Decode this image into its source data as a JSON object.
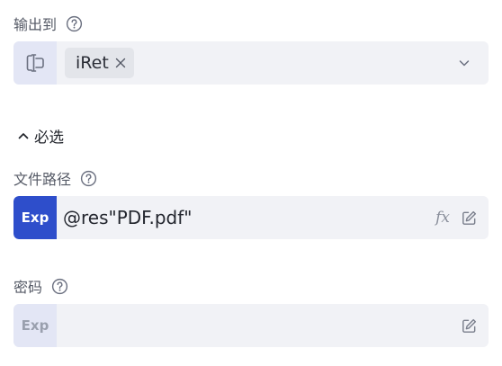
{
  "output_to": {
    "label": "输出到",
    "variable_icon": "variable-icon",
    "tag": {
      "text": "iRet",
      "close_icon": "close-icon"
    },
    "dropdown_icon": "chevron-down-icon"
  },
  "required_section": {
    "caret_icon": "chevron-up-icon",
    "label": "必选"
  },
  "file_path": {
    "label": "文件路径",
    "badge": "Exp",
    "value": "@res\"PDF.pdf\"",
    "fx_label": "fx",
    "edit_icon": "edit-icon"
  },
  "password": {
    "label": "密码",
    "badge": "Exp",
    "value": "",
    "edit_icon": "edit-icon"
  },
  "colors": {
    "accent": "#2e4ecb",
    "field_bg": "#f1f2f6",
    "icon_bg": "#e3e6f5",
    "tag_bg": "#e3e5ea",
    "label": "#555a66"
  }
}
